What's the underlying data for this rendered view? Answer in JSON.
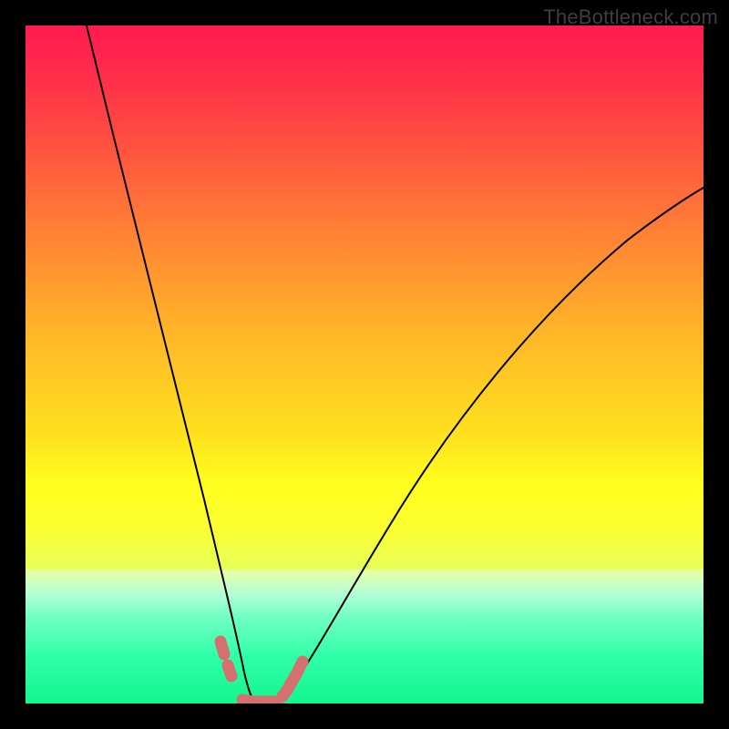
{
  "watermark": "TheBottleneck.com",
  "chart_data": {
    "type": "line",
    "title": "",
    "xlabel": "",
    "ylabel": "",
    "xlim": [
      0,
      100
    ],
    "ylim": [
      0,
      100
    ],
    "grid": false,
    "legend": false,
    "series": [
      {
        "name": "left-curve",
        "x": [
          9,
          12,
          15,
          18,
          21,
          24,
          26,
          28,
          29.5,
          30.5,
          31.2,
          32,
          33
        ],
        "y": [
          100,
          88,
          74,
          60,
          46,
          32,
          21,
          12,
          6,
          2.6,
          1.2,
          0.4,
          0
        ]
      },
      {
        "name": "right-curve",
        "x": [
          36,
          37,
          38,
          39,
          41,
          44,
          48,
          53,
          59,
          66,
          74,
          83,
          92,
          100
        ],
        "y": [
          0,
          0.3,
          1.0,
          2.2,
          5.3,
          11,
          19,
          28,
          38,
          48,
          57,
          65,
          72,
          77
        ]
      },
      {
        "name": "flat-min",
        "x": [
          33,
          34,
          35,
          36
        ],
        "y": [
          0,
          0,
          0,
          0
        ]
      }
    ],
    "markers": [
      {
        "series": "left-curve",
        "x": 28.9,
        "y": 8.1
      },
      {
        "series": "left-curve",
        "x": 29.8,
        "y": 4.5
      },
      {
        "series": "right-curve",
        "x": 37.6,
        "y": 1.2
      },
      {
        "series": "right-curve",
        "x": 38.9,
        "y": 3.1
      },
      {
        "series": "right-curve",
        "x": 39.8,
        "y": 5.3
      },
      {
        "series": "flat-min",
        "x": 32.0,
        "y": 0.0
      },
      {
        "series": "flat-min",
        "x": 34.0,
        "y": 0.0
      },
      {
        "series": "flat-min",
        "x": 36.0,
        "y": 0.0
      }
    ],
    "gradient_colors": {
      "top": "#ff1b50",
      "mid_upper": "#ffb828",
      "mid": "#ffff1e",
      "mid_lower": "#e8ff5a",
      "bottom": "#13f58e"
    }
  }
}
